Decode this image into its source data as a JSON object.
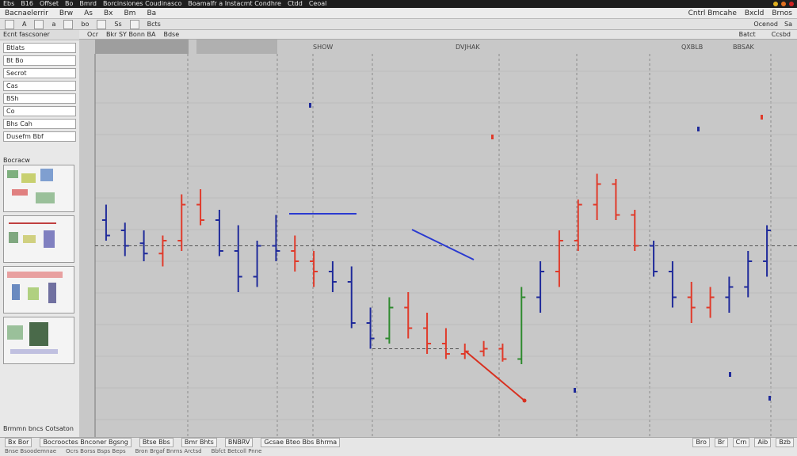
{
  "window": {
    "title_parts": [
      "Ebs",
      "B16",
      "Offset",
      "Bo",
      "Bmrd"
    ],
    "title_mid": "Borcinsiones Coudinasco",
    "title_right": "Boamalfr a Instacmt Condhre",
    "title_end": "Ctdd",
    "title_end2": "Ceoal"
  },
  "menubar": {
    "items": [
      "Bacnaelerrir",
      "Brw",
      "As",
      "Bx",
      "Bm",
      "Ba"
    ],
    "right_items": [
      "Cntrl Bmcahe",
      "Bxcld",
      "Brnos"
    ]
  },
  "toolbar": {
    "left_labels": [
      "A",
      "a",
      "bo",
      "Ss",
      "Bcts"
    ],
    "right_labels": [
      "Ocenod",
      "Sa"
    ]
  },
  "sidebar": {
    "header": "Ecnt fascsoner",
    "fields": [
      "Btlats",
      "Bt Bo",
      "Secrot",
      "Cas",
      "BSh",
      "Co",
      "Bhs Cah",
      "Dusefm Bbf"
    ],
    "panel_label": "Bocracw",
    "status": "Brmmn bncs Cotsaton"
  },
  "chart": {
    "tabs": [
      "Ocr",
      "Bkr SY Bonn BA",
      "Bdse"
    ],
    "tabs_right": [
      "Batct",
      "Ccsbd"
    ],
    "sections": [
      "SHOW",
      "DVJHAK",
      "QXBLB",
      "BBSAK"
    ],
    "colors": {
      "up": "#e03a2a",
      "down": "#1f2a9a",
      "neutral": "#2e8a2e",
      "grid": "#8a8a8a",
      "annotation": "#2a3ad0",
      "arrow": "#d83020"
    }
  },
  "chart_data": {
    "type": "ohlc",
    "series": [
      {
        "o": 56,
        "h": 62,
        "l": 48,
        "c": 50,
        "d": "down"
      },
      {
        "o": 52,
        "h": 55,
        "l": 42,
        "c": 46,
        "d": "down"
      },
      {
        "o": 47,
        "h": 52,
        "l": 40,
        "c": 43,
        "d": "down"
      },
      {
        "o": 43,
        "h": 50,
        "l": 38,
        "c": 48,
        "d": "up"
      },
      {
        "o": 48,
        "h": 66,
        "l": 44,
        "c": 62,
        "d": "up"
      },
      {
        "o": 62,
        "h": 68,
        "l": 54,
        "c": 56,
        "d": "up"
      },
      {
        "o": 56,
        "h": 60,
        "l": 42,
        "c": 44,
        "d": "down"
      },
      {
        "o": 44,
        "h": 54,
        "l": 28,
        "c": 34,
        "d": "down"
      },
      {
        "o": 34,
        "h": 48,
        "l": 30,
        "c": 46,
        "d": "down"
      },
      {
        "o": 46,
        "h": 58,
        "l": 40,
        "c": 44,
        "d": "down"
      },
      {
        "o": 44,
        "h": 50,
        "l": 36,
        "c": 40,
        "d": "up"
      },
      {
        "o": 40,
        "h": 44,
        "l": 30,
        "c": 36,
        "d": "up"
      },
      {
        "o": 36,
        "h": 40,
        "l": 28,
        "c": 32,
        "d": "down"
      },
      {
        "o": 32,
        "h": 38,
        "l": 14,
        "c": 16,
        "d": "down"
      },
      {
        "o": 16,
        "h": 22,
        "l": 6,
        "c": 10,
        "d": "down"
      },
      {
        "o": 10,
        "h": 26,
        "l": 8,
        "c": 22,
        "d": "neutral"
      },
      {
        "o": 22,
        "h": 28,
        "l": 10,
        "c": 14,
        "d": "up"
      },
      {
        "o": 14,
        "h": 20,
        "l": 4,
        "c": 8,
        "d": "up"
      },
      {
        "o": 8,
        "h": 14,
        "l": 2,
        "c": 4,
        "d": "up"
      },
      {
        "o": 4,
        "h": 8,
        "l": 2,
        "c": 5,
        "d": "up"
      },
      {
        "o": 5,
        "h": 9,
        "l": 3,
        "c": 6,
        "d": "up"
      },
      {
        "o": 6,
        "h": 8,
        "l": 1,
        "c": 2,
        "d": "up"
      },
      {
        "o": 2,
        "h": 30,
        "l": 0,
        "c": 26,
        "d": "neutral"
      },
      {
        "o": 26,
        "h": 40,
        "l": 20,
        "c": 36,
        "d": "down"
      },
      {
        "o": 36,
        "h": 52,
        "l": 30,
        "c": 48,
        "d": "up"
      },
      {
        "o": 48,
        "h": 64,
        "l": 44,
        "c": 62,
        "d": "up"
      },
      {
        "o": 62,
        "h": 74,
        "l": 56,
        "c": 70,
        "d": "up"
      },
      {
        "o": 70,
        "h": 72,
        "l": 56,
        "c": 58,
        "d": "up"
      },
      {
        "o": 58,
        "h": 60,
        "l": 44,
        "c": 46,
        "d": "up"
      },
      {
        "o": 46,
        "h": 48,
        "l": 34,
        "c": 36,
        "d": "down"
      },
      {
        "o": 36,
        "h": 40,
        "l": 22,
        "c": 26,
        "d": "down"
      },
      {
        "o": 26,
        "h": 32,
        "l": 16,
        "c": 22,
        "d": "up"
      },
      {
        "o": 22,
        "h": 30,
        "l": 18,
        "c": 26,
        "d": "up"
      },
      {
        "o": 26,
        "h": 34,
        "l": 20,
        "c": 30,
        "d": "down"
      },
      {
        "o": 30,
        "h": 44,
        "l": 26,
        "c": 40,
        "d": "down"
      },
      {
        "o": 40,
        "h": 54,
        "l": 34,
        "c": 52,
        "d": "down"
      }
    ],
    "support_level": 6,
    "resistance_level": 46
  },
  "statusbar": {
    "cells": [
      "Bx Bor",
      "Bocrooctes Bnconer Bgsng",
      "Btse Bbs",
      "Bmr Bhts",
      "BNBRV",
      "Gcsae Bteo Bbs Bhrma"
    ],
    "right_cells": [
      "Bro",
      "Br",
      "Crn",
      "Aib",
      "Bzb"
    ],
    "row2": [
      "Bnse Bsoodemnae",
      "Ocrs Borss Bsps Beps",
      "Bron Brgaf Bnrns Arctsd",
      "Bbfct Betcoll Pnne"
    ]
  }
}
